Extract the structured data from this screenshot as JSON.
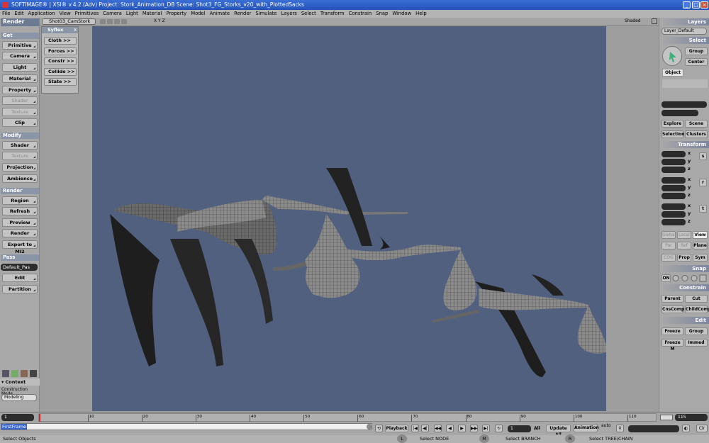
{
  "titlebar": {
    "text": "SOFTIMAGE® | XSI® v.4.2 (Adv) Project: Stork_Animation_DB     Scene: Shot3_FG_Storks_v20_with_PlottedSacks"
  },
  "menu": [
    "File",
    "Edit",
    "Application",
    "View",
    "Primitives",
    "Camera",
    "Light",
    "Material",
    "Property",
    "Model",
    "Animate",
    "Render",
    "Simulate",
    "Layers",
    "Select",
    "Transform",
    "Constrain",
    "Snap",
    "Window",
    "Help"
  ],
  "left": {
    "title": "Render",
    "sections": {
      "get": "Get",
      "modify": "Modify",
      "render": "Render",
      "pass": "Pass"
    },
    "get": [
      "Primitive",
      "Camera",
      "Light",
      "Material",
      "Property",
      "Shader",
      "Texture",
      "Clip"
    ],
    "modify": [
      "Shader",
      "Texture",
      "Projection",
      "Ambience"
    ],
    "render": [
      "Region",
      "Refresh",
      "Preview",
      "Render",
      "Export to MI2"
    ],
    "pass_value": "Default_Pas",
    "pass": [
      "Edit",
      "Partition"
    ],
    "context": "Context",
    "construction_label": "Construction Mode",
    "construction_value": "Modeling"
  },
  "viewport": {
    "camera": "Shot03_CamStork",
    "display": "Shaded",
    "axes": "X Y Z"
  },
  "syflex": {
    "title": "Syflex",
    "items": [
      "Cloth  >>",
      "Forces >>",
      "Constr >>",
      "Collide >>",
      "State  >>"
    ]
  },
  "right": {
    "layers": "Layers",
    "layer_value": "Layer_Default",
    "select": "Select",
    "group": "Group",
    "center": "Center",
    "object": "Object",
    "explore": "Explore",
    "scene": "Scene",
    "selection": "Selection",
    "clusters": "Clusters",
    "transform": "Transform",
    "axes": [
      "x",
      "y",
      "z"
    ],
    "s": "s",
    "r": "r",
    "t": "t",
    "global": "Global",
    "local": "Local",
    "view": "View",
    "par": "Par",
    "ref": "Ref",
    "plane": "Plane",
    "cog": "COG",
    "prop": "Prop",
    "sym": "Sym",
    "snap": "Snap",
    "on": "ON",
    "constrain": "Constrain",
    "parent": "Parent",
    "cut": "Cut",
    "cnscomp": "CnsComp",
    "childcomp": "ChildComp",
    "edit": "Edit",
    "freeze": "Freeze",
    "group2": "Group",
    "freezem": "Freeze M",
    "immed": "Immed"
  },
  "timeline": {
    "start": "1",
    "end": "115",
    "ticks": [
      "10",
      "20",
      "30",
      "40",
      "50",
      "60",
      "70",
      "80",
      "90",
      "100",
      "110"
    ]
  },
  "bottom": {
    "command": "FirstFrame",
    "playback": "Playback",
    "frame": "1",
    "all": "All",
    "update": "Update All",
    "animation": "Animation",
    "auto": "auto",
    "clr": "Clr"
  },
  "status": {
    "left": "Select Objects",
    "l": "L",
    "node": "Select NODE",
    "m": "M",
    "branch": "Select BRANCH",
    "r": "R",
    "tree": "Select TREE/CHAIN"
  }
}
